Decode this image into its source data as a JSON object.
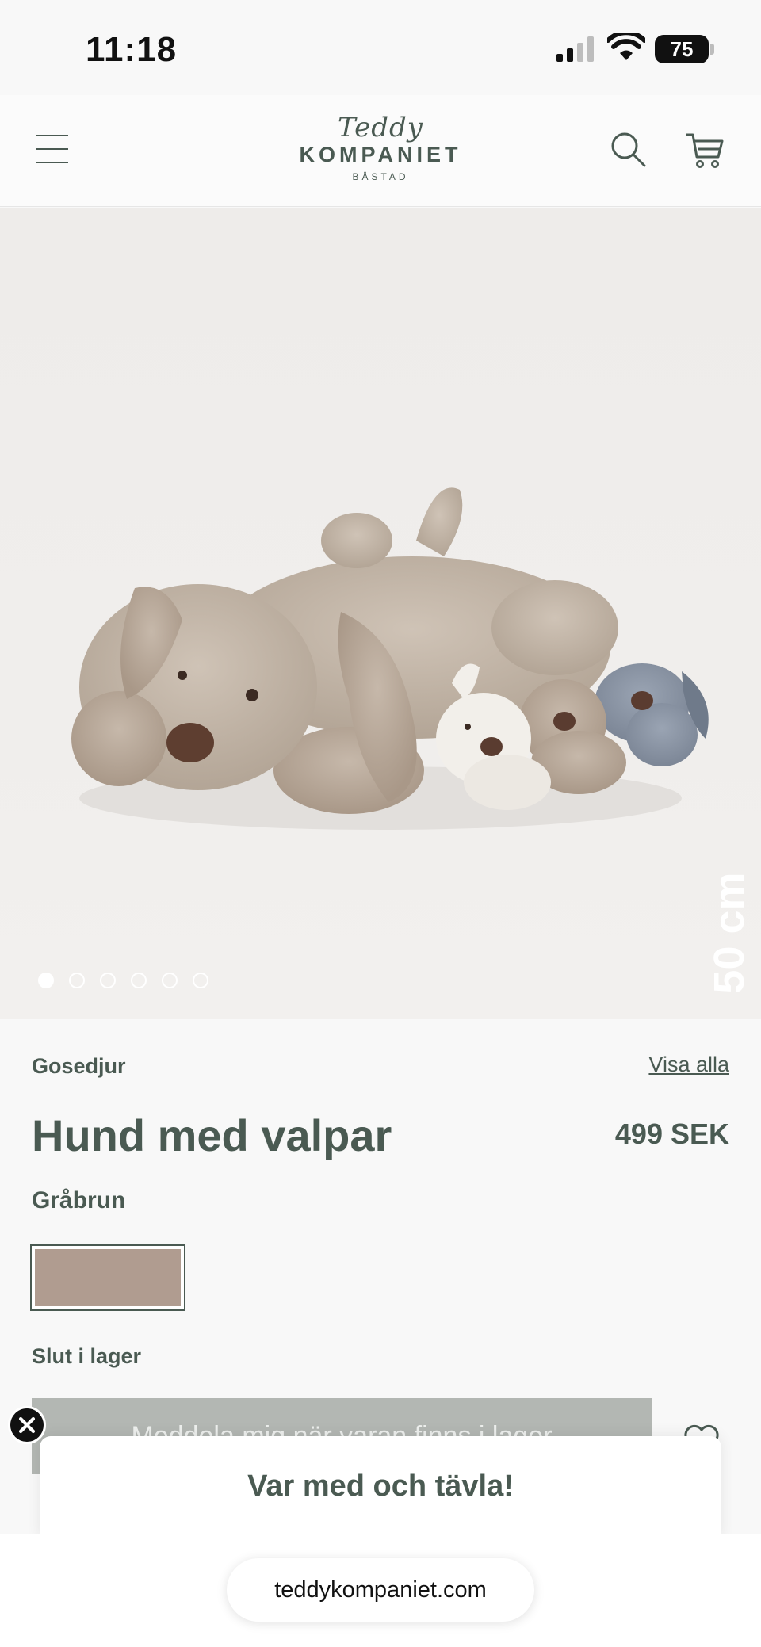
{
  "status_bar": {
    "time": "11:18",
    "battery": "75",
    "icons": [
      "signal-icon",
      "wifi-icon",
      "battery-icon"
    ]
  },
  "header": {
    "logo": {
      "script": "Teddy",
      "main": "KOMPANIET",
      "sub": "BÅSTAD"
    },
    "icons": [
      "menu-icon",
      "search-icon",
      "cart-icon"
    ]
  },
  "gallery": {
    "size_label": "50 cm",
    "dots": 6,
    "active_index": 0
  },
  "product": {
    "category": "Gosedjur",
    "view_all": "Visa alla",
    "title": "Hund med valpar",
    "price": "499 SEK",
    "color_name": "Gråbrun",
    "swatch_color": "#b09c90",
    "stock_status": "Slut i lager",
    "notify_button": "Meddela mig när varan finns i lager",
    "wishlist_icon": "heart-icon"
  },
  "popup": {
    "title": "Var med och tävla!",
    "close_icon": "close-icon"
  },
  "browser": {
    "url": "teddykompaniet.com"
  },
  "colors": {
    "brand": "#4a5a52",
    "button_disabled": "#b3b7b3",
    "background": "#f8f8f8"
  }
}
